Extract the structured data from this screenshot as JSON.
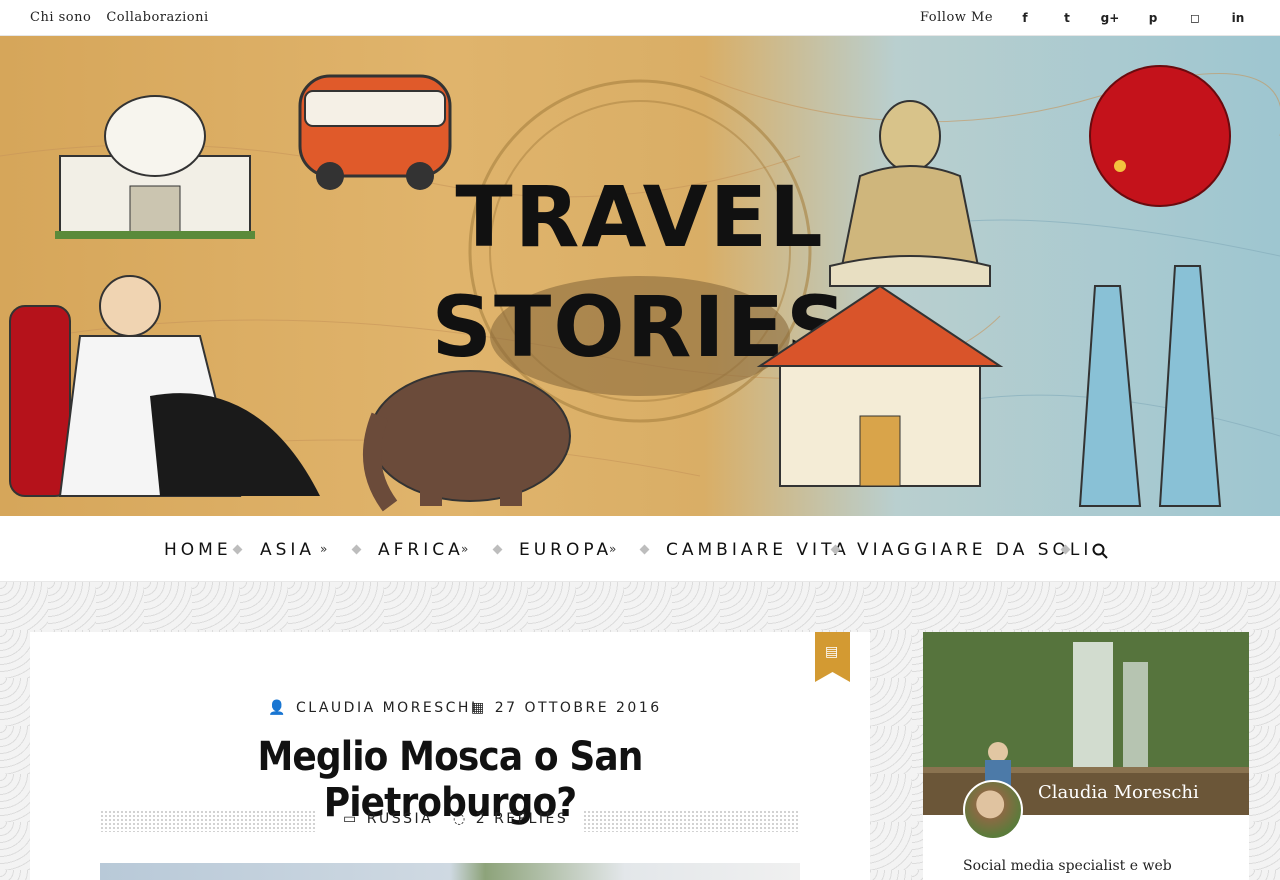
{
  "topbar": {
    "links": [
      "Chi sono",
      "Collaborazioni"
    ],
    "follow_label": "Follow Me",
    "social": [
      {
        "name": "facebook",
        "glyph": "f"
      },
      {
        "name": "twitter",
        "glyph": "t"
      },
      {
        "name": "google-plus",
        "glyph": "g+"
      },
      {
        "name": "pinterest",
        "glyph": "p"
      },
      {
        "name": "instagram",
        "glyph": "◻"
      },
      {
        "name": "linkedin",
        "glyph": "in"
      }
    ]
  },
  "header": {
    "logo_line1": "TRAVEL",
    "logo_line2": "STORIES"
  },
  "nav": {
    "items": [
      "HOME",
      "ASIA",
      "AFRICA",
      "EUROPA",
      "CAMBIARE VITA",
      "VIAGGIARE DA SOLI"
    ],
    "search_icon": "search-icon"
  },
  "post": {
    "author": "CLAUDIA MORESCHI",
    "date": "27 OTTOBRE 2016",
    "title": "Meglio Mosca o San Pietroburgo?",
    "category": "RUSSIA",
    "replies": "2 REPLIES",
    "format_icon": "document-icon"
  },
  "sidebar": {
    "name": "Claudia Moreschi",
    "bio": "Social media specialist e web"
  },
  "colors": {
    "accent": "#d39a32",
    "text": "#222222"
  }
}
